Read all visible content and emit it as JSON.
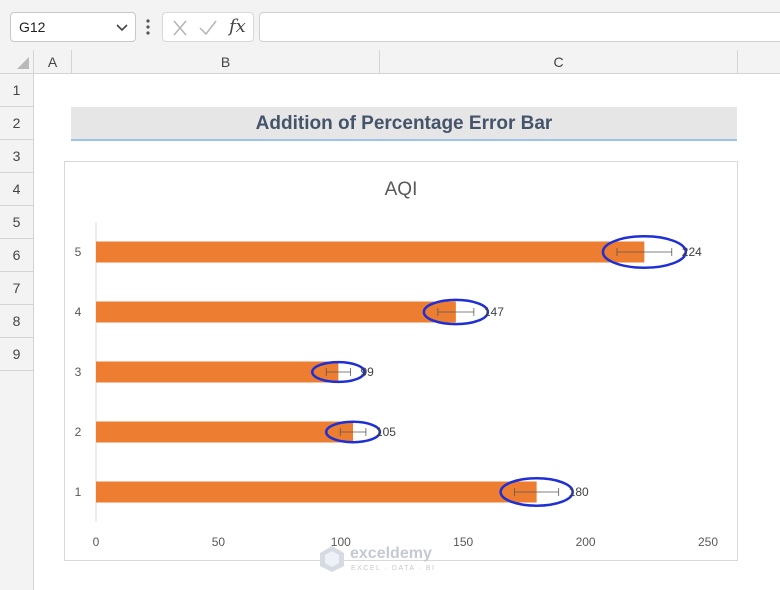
{
  "formula_bar": {
    "name_box": "G12",
    "fx_label": "fx",
    "formula": ""
  },
  "columns": [
    {
      "label": "A"
    },
    {
      "label": "B"
    },
    {
      "label": "C"
    }
  ],
  "rows": [
    "1",
    "2",
    "3",
    "4",
    "5",
    "6",
    "7",
    "8",
    "9"
  ],
  "sheet_title": "Addition of Percentage Error Bar",
  "colors": {
    "bar": "#ed7d31",
    "highlight": "#1f2fd6",
    "error_bar": "#595959"
  },
  "chart_data": {
    "type": "bar",
    "orientation": "horizontal",
    "title": "AQI",
    "categories": [
      "1",
      "2",
      "3",
      "4",
      "5"
    ],
    "values": [
      180,
      105,
      99,
      147,
      224
    ],
    "data_labels": [
      "180",
      "105",
      "99",
      "147",
      "224"
    ],
    "error_bar_percent": 5,
    "xlim": [
      0,
      250
    ],
    "xticks": [
      0,
      50,
      100,
      150,
      200,
      250
    ],
    "grid": false,
    "legend": "none"
  },
  "watermark": {
    "name": "exceldemy",
    "tagline": "EXCEL · DATA · BI"
  }
}
